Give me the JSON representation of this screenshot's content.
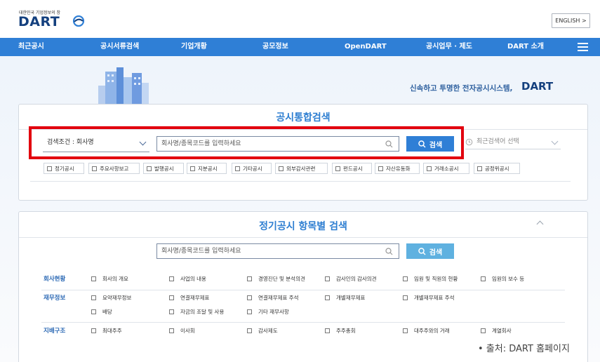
{
  "header": {
    "logo_small": "대한민국 기업정보의 창",
    "logo_main": "DART",
    "english_label": "ENGLISH >"
  },
  "nav": {
    "items": [
      "최근공시",
      "공시서류검색",
      "기업개황",
      "공모정보",
      "OpenDART",
      "공시업무 · 제도",
      "DART 소개"
    ]
  },
  "hero": {
    "tagline": "신속하고 투명한 전자공시시스템,",
    "tagline_brand": "DART"
  },
  "integrated": {
    "title": "공시통합검색",
    "condition_label": "검색조건 : 회사명",
    "input_placeholder": "회사명/종목코드를 입력하세요",
    "search_label": "검색",
    "recent_label": "최근검색어 선택",
    "filters": [
      "정기공시",
      "주요사항보고",
      "발행공시",
      "지분공시",
      "기타공시",
      "외부감사관련",
      "펀드공시",
      "자산유동화",
      "거래소공시",
      "공정위공시"
    ]
  },
  "periodic": {
    "title": "정기공시 항목별 검색",
    "input_placeholder": "회사명/종목코드를 입력하세요",
    "search_label": "검색",
    "rows": [
      {
        "label": "회사현황",
        "items": [
          "회사의 개요",
          "사업의 내용",
          "경영진단 및 분석의견",
          "감사인의 감사의견",
          "임원 및 직원의 현황",
          "임원의 보수 등"
        ]
      },
      {
        "label": "재무정보",
        "items": [
          "요약재무정보",
          "연결재무제표",
          "연결재무제표 주석",
          "개별재무제표",
          "개별재무제표 주석",
          "배당",
          "자금의 조달 및 사용",
          "기타 재무사항"
        ]
      },
      {
        "label": "지배구조",
        "items": [
          "최대주주",
          "이사회",
          "감사제도",
          "주주총회",
          "대주주와의 거래",
          "계열회사"
        ]
      }
    ]
  },
  "source": "• 출처: DART 홈페이지",
  "colors": {
    "nav": "#2f7fd6",
    "title": "#2d7ed1",
    "highlight": "#e2000e",
    "brand": "#14407e"
  }
}
